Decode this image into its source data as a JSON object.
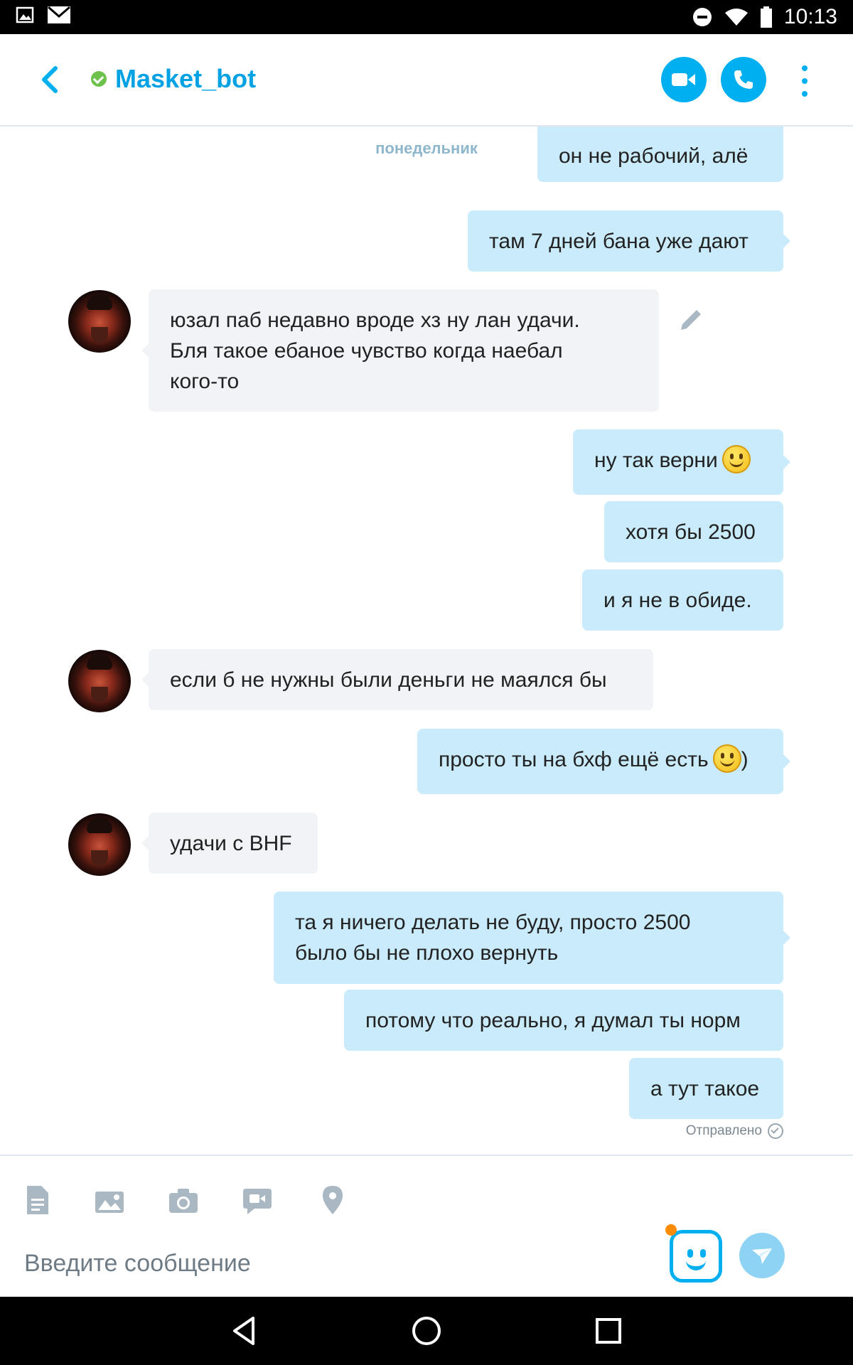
{
  "status_bar": {
    "time": "10:13"
  },
  "header": {
    "contact_name": "Masket_bot",
    "online": true
  },
  "chat": {
    "day_separator": "понедельник",
    "messages": [
      {
        "dir": "out",
        "text": "он не рабочий, алё"
      },
      {
        "dir": "out",
        "text": "там 7 дней бана уже дают"
      },
      {
        "dir": "in",
        "text": "юзал паб недавно вроде хз ну лан удачи.\nБля такое ебаное чувство когда наебал\nкого-то",
        "edited": true
      },
      {
        "dir": "out",
        "text": "ну так верни",
        "emoji": "smile"
      },
      {
        "dir": "out",
        "text": "хотя бы 2500"
      },
      {
        "dir": "out",
        "text": "и я не в обиде."
      },
      {
        "dir": "in",
        "text": "если б не нужны были деньги не маялся бы"
      },
      {
        "dir": "out",
        "text": "просто ты на бхф ещё есть",
        "emoji": "smile",
        "suffix": ")"
      },
      {
        "dir": "in",
        "text": "удачи с BHF"
      },
      {
        "dir": "out",
        "text": "та я ничего делать не буду, просто 2500\nбыло бы не плохо вернуть"
      },
      {
        "dir": "out",
        "text": "потому что реально, я думал ты норм"
      },
      {
        "dir": "out",
        "text": "а тут такое"
      }
    ],
    "delivery_status": "Отправлено"
  },
  "composer": {
    "placeholder": "Введите сообщение",
    "tools": [
      "file-icon",
      "photo-gallery-icon",
      "camera-icon",
      "video-message-icon",
      "location-icon"
    ]
  },
  "colors": {
    "accent": "#00aff0",
    "outgoing_bubble": "#c9ebfb",
    "incoming_bubble": "#f1f3f6",
    "online": "#6cc24a"
  }
}
